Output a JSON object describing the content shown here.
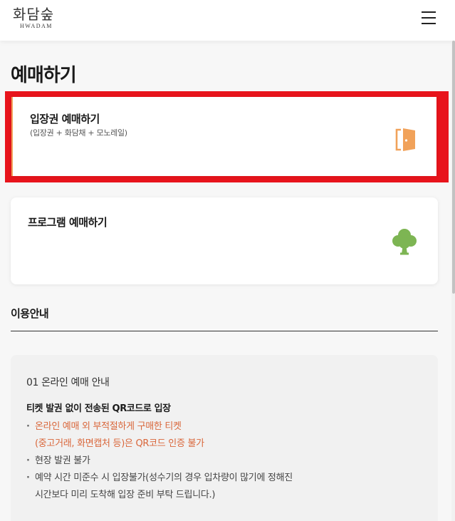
{
  "header": {
    "logo_ko": "화담숲",
    "logo_en": "HWADAM"
  },
  "page": {
    "title": "예매하기"
  },
  "cards": {
    "ticket": {
      "title": "입장권 예매하기",
      "subtitle": "(입장권 + 화담채 + 모노레일)",
      "icon": "door-icon",
      "icon_color": "#f1a25a"
    },
    "program": {
      "title": "프로그램 예매하기",
      "icon": "tree-icon",
      "icon_color": "#7db553"
    }
  },
  "guide": {
    "title": "이용안내",
    "box_heading": "01 온라인 예매 안내",
    "box_subheading": "티켓 발권 없이 전송된 QR코드로 입장",
    "bullets": [
      {
        "line1": "온라인 예매 외 부적절하게 구매한 티켓",
        "line2": "(중고거래, 화면캡처 등)은 QR코드 인증 불가",
        "color": "#d9663a"
      },
      {
        "line1": "현장 발권 불가"
      },
      {
        "line1": "예약 시간 미준수 시 입장불가(성수기의 경우 입차량이 많기에 정해진",
        "line2": "시간보다 미리 도착해 입장 준비 부탁 드립니다.)"
      }
    ]
  },
  "colors": {
    "highlight": "#e8141c",
    "accent_orange": "#d9663a"
  }
}
